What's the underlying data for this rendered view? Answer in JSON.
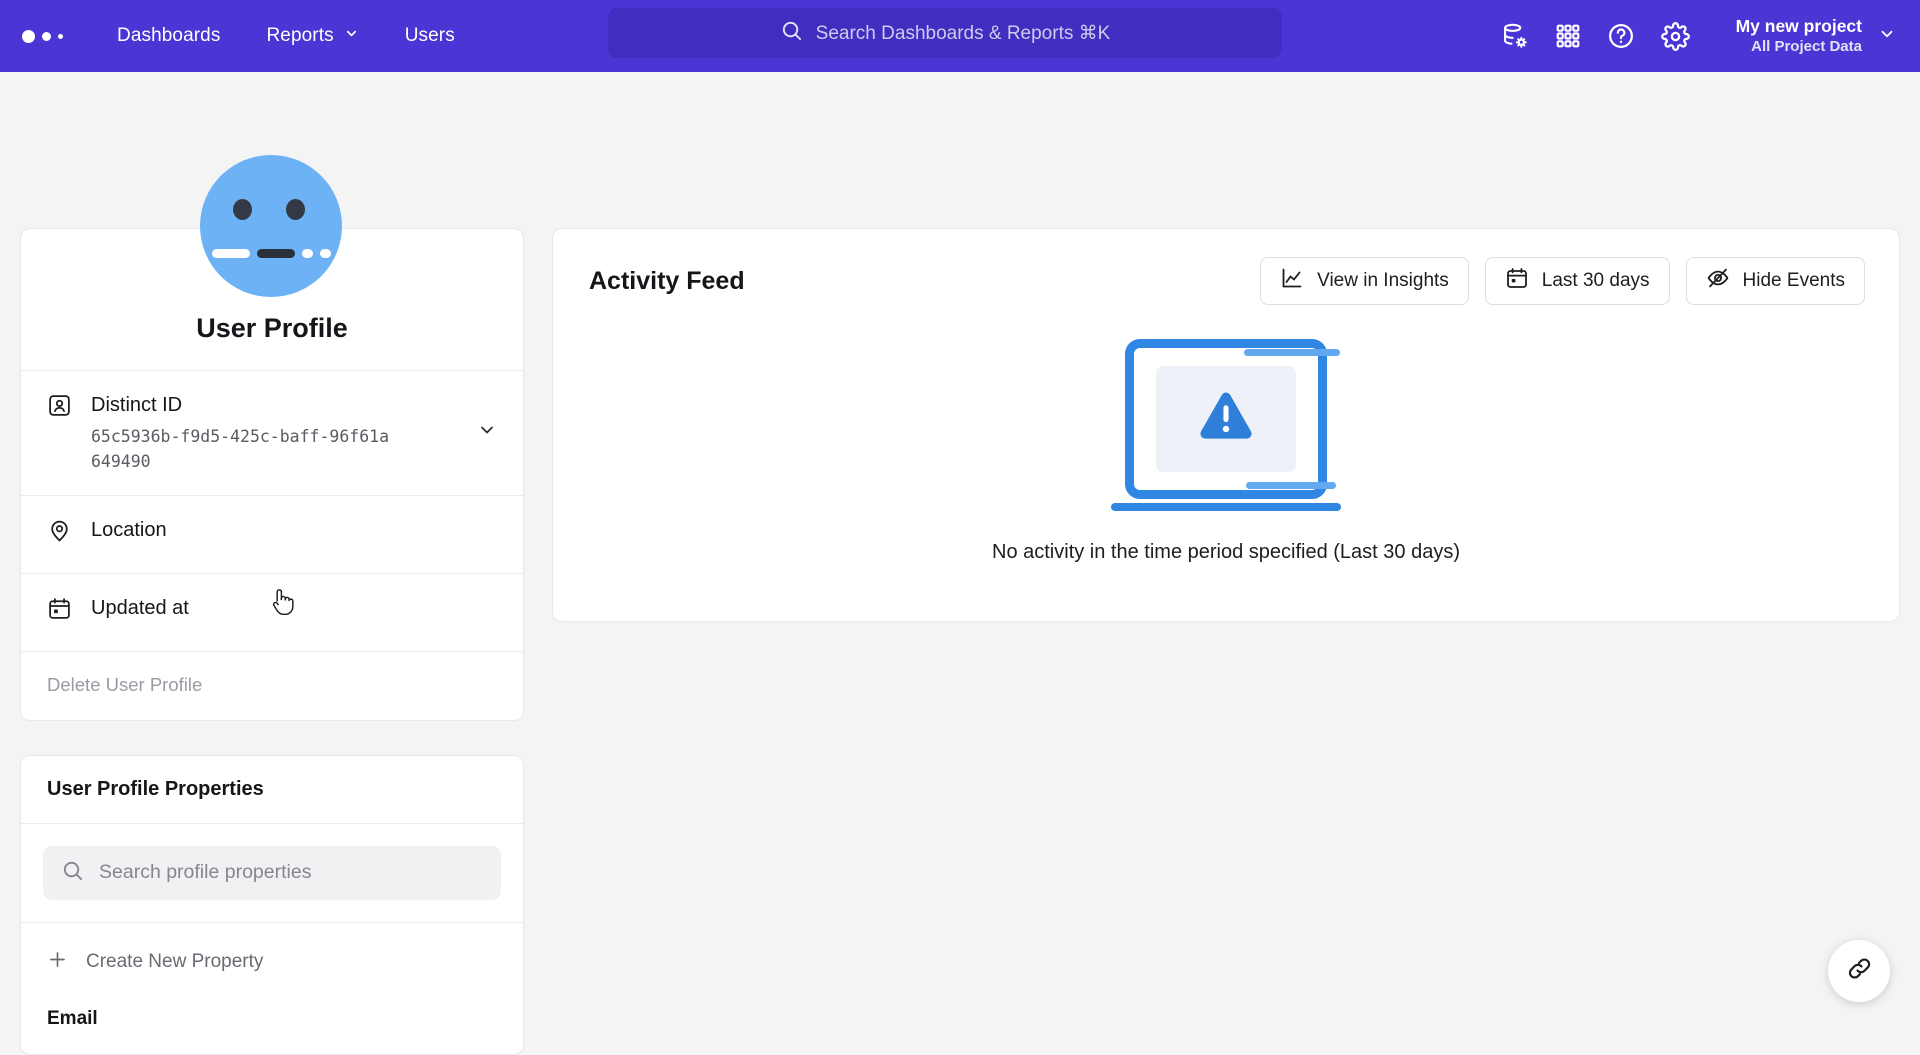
{
  "theme": {
    "brand_purple": "#4b35d4",
    "search_purple": "#3f2ec0",
    "page_bg": "#f4f4f5",
    "card_bg": "#ffffff",
    "avatar_blue": "#6cb2f5",
    "illustration_blue": "#2f86e3"
  },
  "topbar": {
    "logo_icon": "mixpanel-dots-logo",
    "nav": [
      {
        "label": "Dashboards",
        "icon": null
      },
      {
        "label": "Reports",
        "icon": "chevron-down-icon"
      },
      {
        "label": "Users",
        "icon": null
      }
    ],
    "search": {
      "icon": "search-icon",
      "placeholder": "Search Dashboards & Reports ⌘K"
    },
    "icons": [
      {
        "name": "data-management-icon"
      },
      {
        "name": "apps-grid-icon"
      },
      {
        "name": "help-circle-icon"
      },
      {
        "name": "gear-icon"
      }
    ],
    "project": {
      "name": "My new project",
      "subtitle": "All Project Data",
      "chevron": "chevron-down-icon"
    }
  },
  "profile_card": {
    "avatar_icon": "user-avatar-face",
    "title": "User Profile",
    "rows": [
      {
        "icon": "id-card-icon",
        "label": "Distinct ID",
        "value": "65c5936b-f9d5-425c-baff-96f61a649490",
        "chevron": "chevron-down-icon"
      },
      {
        "icon": "location-pin-icon",
        "label": "Location",
        "value": ""
      },
      {
        "icon": "calendar-icon",
        "label": "Updated at",
        "value": ""
      }
    ],
    "delete_label": "Delete User Profile"
  },
  "properties_card": {
    "title": "User Profile Properties",
    "search": {
      "icon": "search-icon",
      "placeholder": "Search profile properties"
    },
    "create_label": "Create New Property",
    "create_icon": "plus-icon",
    "first_property": "Email"
  },
  "activity_feed": {
    "title": "Activity Feed",
    "actions": [
      {
        "label": "View in Insights",
        "icon": "line-chart-icon"
      },
      {
        "label": "Last 30 days",
        "icon": "calendar-icon"
      },
      {
        "label": "Hide Events",
        "icon": "eye-off-icon"
      }
    ],
    "empty_state": {
      "illustration": "laptop-warning-illustration",
      "message": "No activity in the time period specified (Last 30 days)"
    }
  },
  "fab": {
    "icon": "link-icon"
  },
  "cursor": {
    "icon": "pointing-hand-cursor"
  }
}
